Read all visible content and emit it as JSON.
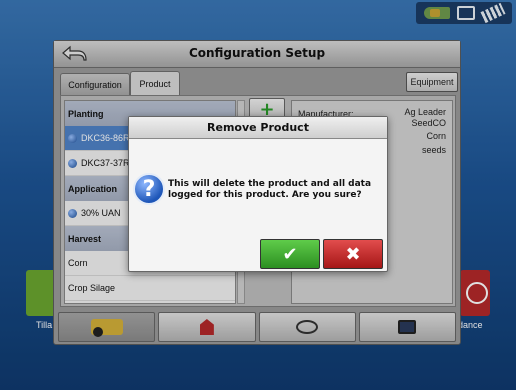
{
  "window": {
    "title": "Configuration Setup",
    "tabs": [
      {
        "label": "Configuration"
      },
      {
        "label": "Product"
      }
    ],
    "equipment_button": "Equipment"
  },
  "product_list": {
    "groups": [
      {
        "header": "Planting",
        "items": [
          "DKC36-86R",
          "DKC37-37R"
        ]
      },
      {
        "header": "Application",
        "items": [
          "30% UAN"
        ]
      },
      {
        "header": "Harvest",
        "items": [
          "Corn",
          "Crop Silage"
        ]
      }
    ],
    "selected_item": "DKC36-86R"
  },
  "details": {
    "manufacturer_key": "Manufacturer:",
    "manufacturer_values": [
      "Ag Leader",
      "SeedCO"
    ],
    "crop": "Corn",
    "unit": "seeds"
  },
  "side_tiles": {
    "left_label": "Tilla",
    "right_label": "dance"
  },
  "modal": {
    "title": "Remove Product",
    "icon_glyph": "?",
    "message": "This will delete the product and all data logged for this product.  Are you sure?",
    "confirm_glyph": "✔",
    "cancel_glyph": "✖"
  },
  "icons": {
    "back": "back-arrow-icon",
    "add": "plus-icon",
    "status": [
      "harvester-icon",
      "cards-icon",
      "satellite-icon"
    ],
    "bottom_bar": [
      "tractor-icon",
      "barn-icon",
      "steering-wheel-icon",
      "monitor-icon"
    ]
  },
  "colors": {
    "background": "#1d5596",
    "selected_item": "#4f82c6",
    "confirm": "#2c8f21",
    "cancel": "#a51616",
    "accent_green": "#6aa52f",
    "accent_red": "#b3282a"
  }
}
